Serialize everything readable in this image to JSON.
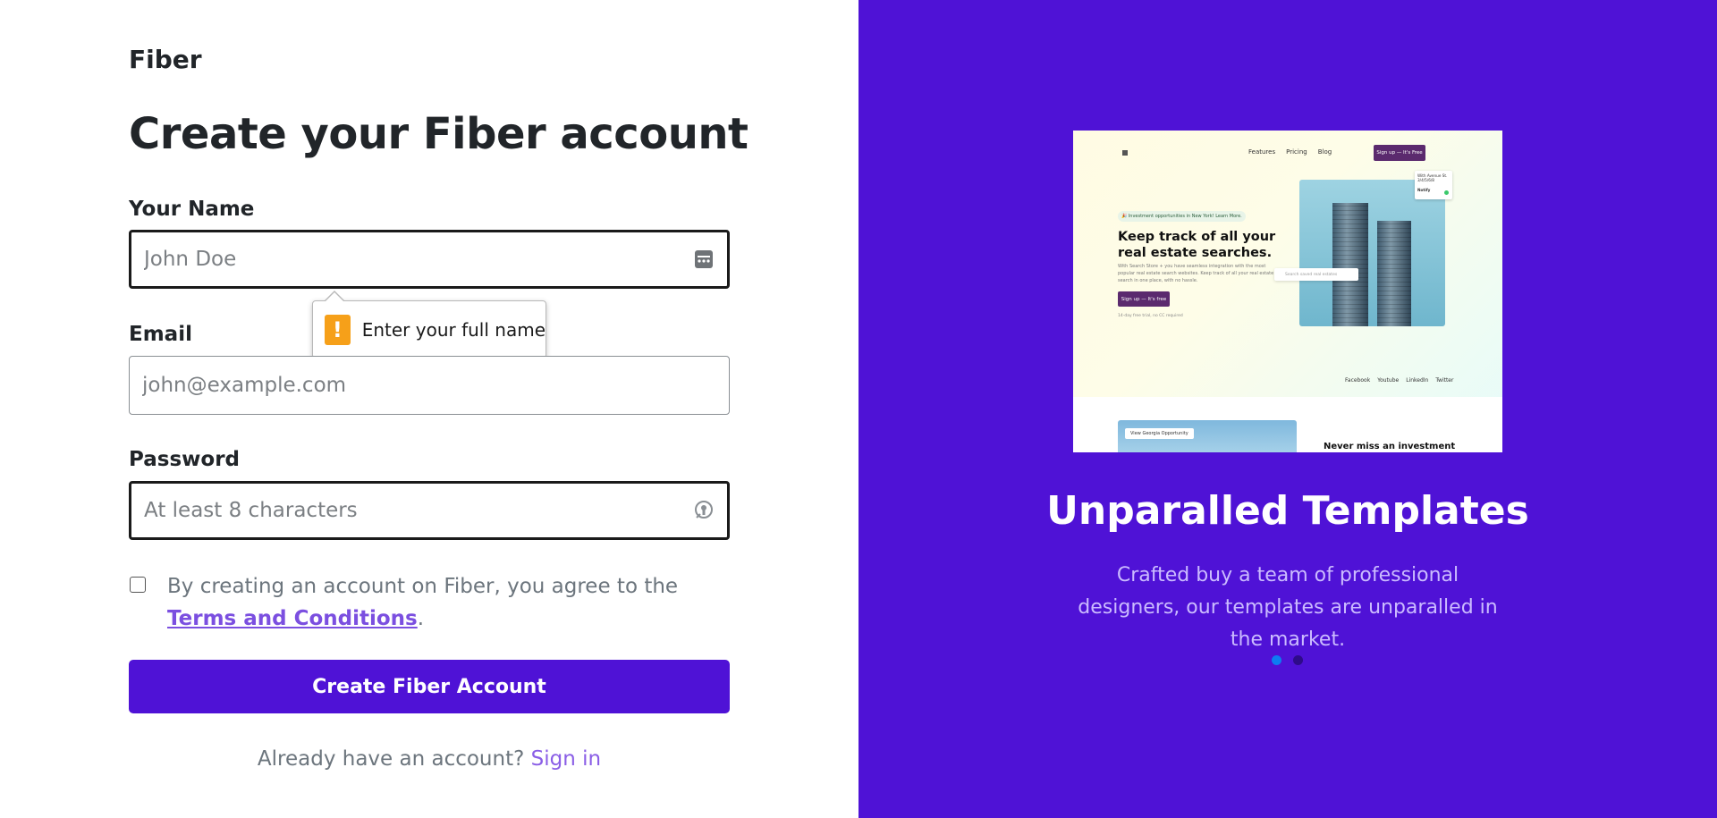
{
  "brand": "Fiber",
  "title": "Create your Fiber account",
  "form": {
    "name_label": "Your Name",
    "name_placeholder": "John Doe",
    "name_tooltip": "Enter your full name",
    "email_label": "Email",
    "email_placeholder": "john@example.com",
    "password_label": "Password",
    "password_placeholder": "At least 8 characters",
    "terms_text": "By creating an account on Fiber, you agree to the",
    "terms_link": "Terms and Conditions",
    "terms_period": ".",
    "terms_checked": false,
    "submit_label": "Create Fiber Account",
    "signin_prompt": "Already have an account?",
    "signin_link": "Sign in"
  },
  "promo": {
    "title": "Unparalled Templates",
    "subtitle": "Crafted buy a team of professional designers, our templates are unparalled in the market.",
    "dots": [
      {
        "active": true,
        "color": "#0d7cf2"
      },
      {
        "active": false,
        "color": "#2e0b8a"
      }
    ],
    "background": "#4f12d6"
  },
  "preview": {
    "nav": [
      "Features",
      "Pricing",
      "Blog"
    ],
    "nav_button": "Sign up — It's Free",
    "badge": "🎉 Investment opportunities in New York! Learn More.",
    "headline": "Keep track of all your real estate searches.",
    "description": "With Search Store + you have seamless integration with the most popular real estate search websites. Keep track of all your real estate search in one place, with no hassle.",
    "cta": "Sign up — It's free",
    "footnote": "14-day free trial, no CC required",
    "card_text": "With Avenue St. 3/4/5/6/8",
    "card_label": "Notify",
    "search_placeholder": "Search saved real estates",
    "links": [
      "Facebook",
      "Youtube",
      "LinkedIn",
      "Twitter"
    ],
    "tag": "View Georgia Opportunity",
    "section_title": "Never miss an investment"
  },
  "colors": {
    "primary": "#4f12d6",
    "link": "#7b4fe0",
    "warning": "#f6a019"
  }
}
